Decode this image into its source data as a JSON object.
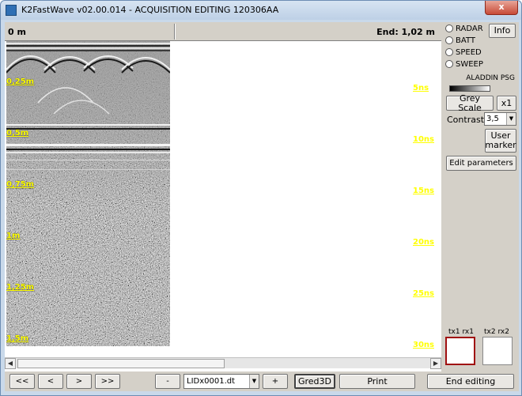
{
  "window": {
    "title": "K2FastWave v02.00.014 - ACQUISITION EDITING   120306AA",
    "close_glyph": "x"
  },
  "header": {
    "start_label": "0 m",
    "end_label": "End: 1,02 m"
  },
  "depth_labels": [
    "0,25m",
    "0,5m",
    "0,75m",
    "1m",
    "1,25m",
    "1,5m"
  ],
  "time_labels": [
    "5ns",
    "10ns",
    "15ns",
    "20ns",
    "25ns",
    "30ns"
  ],
  "side_panel": {
    "info_label": "Info",
    "radios": [
      "RADAR",
      "BATT",
      "SPEED",
      "SWEEP"
    ],
    "colormap_name": "ALADDIN PSG",
    "grey_scale_label": "Grey Scale",
    "zoom_label": "x1",
    "contrast_label": "Contrast",
    "contrast_value": "3,5",
    "user_marker_label": "User\nmarker",
    "edit_params_label": "Edit parameters",
    "tx1_label": "tx1 rx1",
    "tx2_label": "tx2 rx2"
  },
  "bottom_bar": {
    "first_label": "<<",
    "prev_label": "<",
    "next_label": ">",
    "last_label": ">>",
    "minus_label": "-",
    "file_value": "LIDx0001.dt",
    "plus_label": "+",
    "gred3d_label": "Gred3D",
    "print_label": "Print",
    "end_editing_label": "End editing"
  },
  "colors": {
    "label_yellow": "#ffff00",
    "active_channel_border": "#a01010"
  }
}
